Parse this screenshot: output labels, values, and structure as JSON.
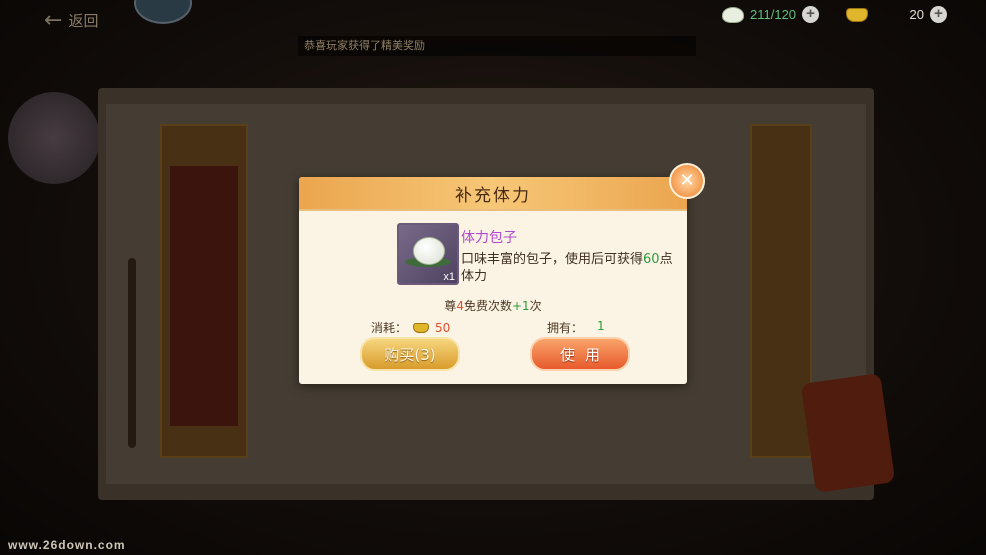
{
  "topbar": {
    "back_label": "返回",
    "stamina": "211/120",
    "gold": "20"
  },
  "ticker": {
    "text": "恭喜玩家获得了精美奖励"
  },
  "dialog": {
    "title": "补充体力",
    "item": {
      "name": "体力包子",
      "quantity": "x1",
      "desc_prefix": "口味丰富的包子，使用后可获得",
      "desc_value": "60",
      "desc_suffix": "点体力"
    },
    "free": {
      "prefix": "尊",
      "count": "4",
      "middle": "免费次数",
      "bonus": "+1",
      "suffix": "次"
    },
    "cost_label": "消耗：",
    "cost_value": "50",
    "own_label": "拥有：",
    "own_value": "1",
    "buy_label": "购买(3)",
    "use_label": "使用"
  },
  "watermark": "www.26down.com",
  "colors": {
    "title_bar": "#f6c777",
    "item_name": "#b04ad0",
    "green": "#2d9b3c",
    "red": "#e0502e",
    "buy_button": "#e4ad45",
    "use_button": "#ee7a45"
  }
}
